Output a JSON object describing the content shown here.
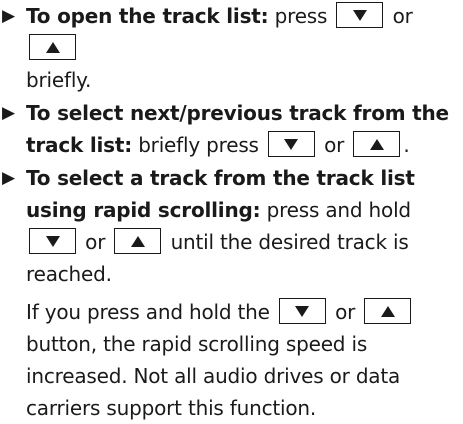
{
  "icons": {
    "bullet": "right-triangle-bullet-icon",
    "down_key": "down-arrow-key-icon",
    "up_key": "up-arrow-key-icon"
  },
  "items": [
    {
      "lead": "To open the track list:",
      "text_1": "press",
      "or_1": "or",
      "text_2": "briefly."
    },
    {
      "lead": "To select next/previous track from the track list:",
      "text_1": "briefly press",
      "or_1": "or",
      "text_2": "."
    },
    {
      "lead": "To select a track from the track list using rapid scrolling:",
      "text_1": "press and hold",
      "or_1": "or",
      "text_2": "until the desired track is reached.",
      "para_1": "If you press and hold the",
      "or_2": "or",
      "para_2": "button, the rapid scrolling speed is increased. Not all audio drives or data carriers support this function."
    }
  ]
}
